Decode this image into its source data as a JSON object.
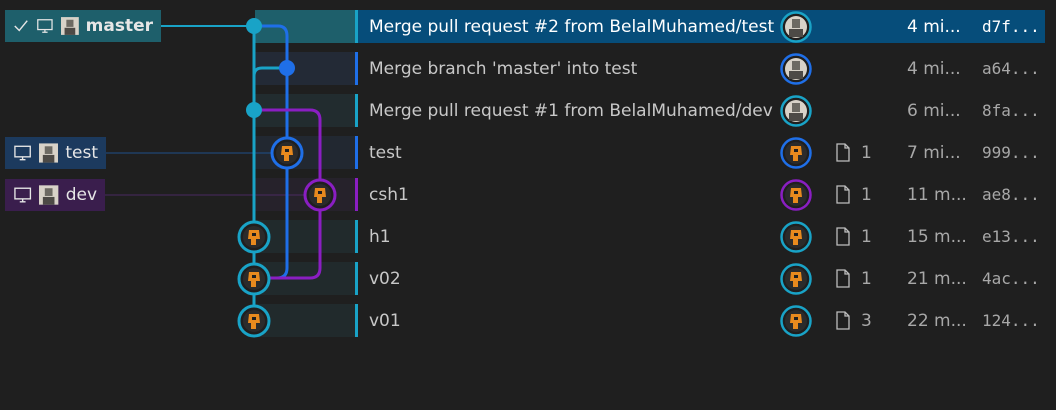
{
  "colors": {
    "background": "#1f1f1f",
    "selected_row": "#064d7a",
    "lane_cyan": "#19a3c7",
    "lane_blue": "#1f6fe8",
    "lane_purple": "#8a1ec2",
    "master_label_bg": "#1e5f6b",
    "test_label_bg": "#1c3a5e",
    "dev_label_bg": "#3a1e4d"
  },
  "branches": {
    "master": {
      "name": "master",
      "checked_out": true,
      "icons": [
        "check-icon",
        "computer-icon",
        "avatar"
      ]
    },
    "test": {
      "name": "test",
      "icons": [
        "computer-icon",
        "avatar"
      ]
    },
    "dev": {
      "name": "dev",
      "icons": [
        "computer-icon",
        "avatar"
      ]
    }
  },
  "commits": [
    {
      "message": "Merge pull request #2 from BelalMuhamed/test",
      "files": "",
      "time": "4 mi...",
      "sha": "d7f...",
      "selected": true,
      "lane": "cyan"
    },
    {
      "message": "Merge branch 'master' into test",
      "files": "",
      "time": "4 mi...",
      "sha": "a64...",
      "selected": false,
      "lane": "blue"
    },
    {
      "message": "Merge pull request #1 from BelalMuhamed/dev",
      "files": "",
      "time": "6 mi...",
      "sha": "8fa...",
      "selected": false,
      "lane": "cyan"
    },
    {
      "message": "test",
      "files": "1",
      "time": "7 mi...",
      "sha": "999...",
      "selected": false,
      "lane": "blue"
    },
    {
      "message": "csh1",
      "files": "1",
      "time": "11 m...",
      "sha": "ae8...",
      "selected": false,
      "lane": "purple"
    },
    {
      "message": "h1",
      "files": "1",
      "time": "15 m...",
      "sha": "e13...",
      "selected": false,
      "lane": "cyan"
    },
    {
      "message": "v02",
      "files": "1",
      "time": "21 m...",
      "sha": "4ac...",
      "selected": false,
      "lane": "cyan"
    },
    {
      "message": "v01",
      "files": "3",
      "time": "22 m...",
      "sha": "124...",
      "selected": false,
      "lane": "cyan"
    }
  ]
}
